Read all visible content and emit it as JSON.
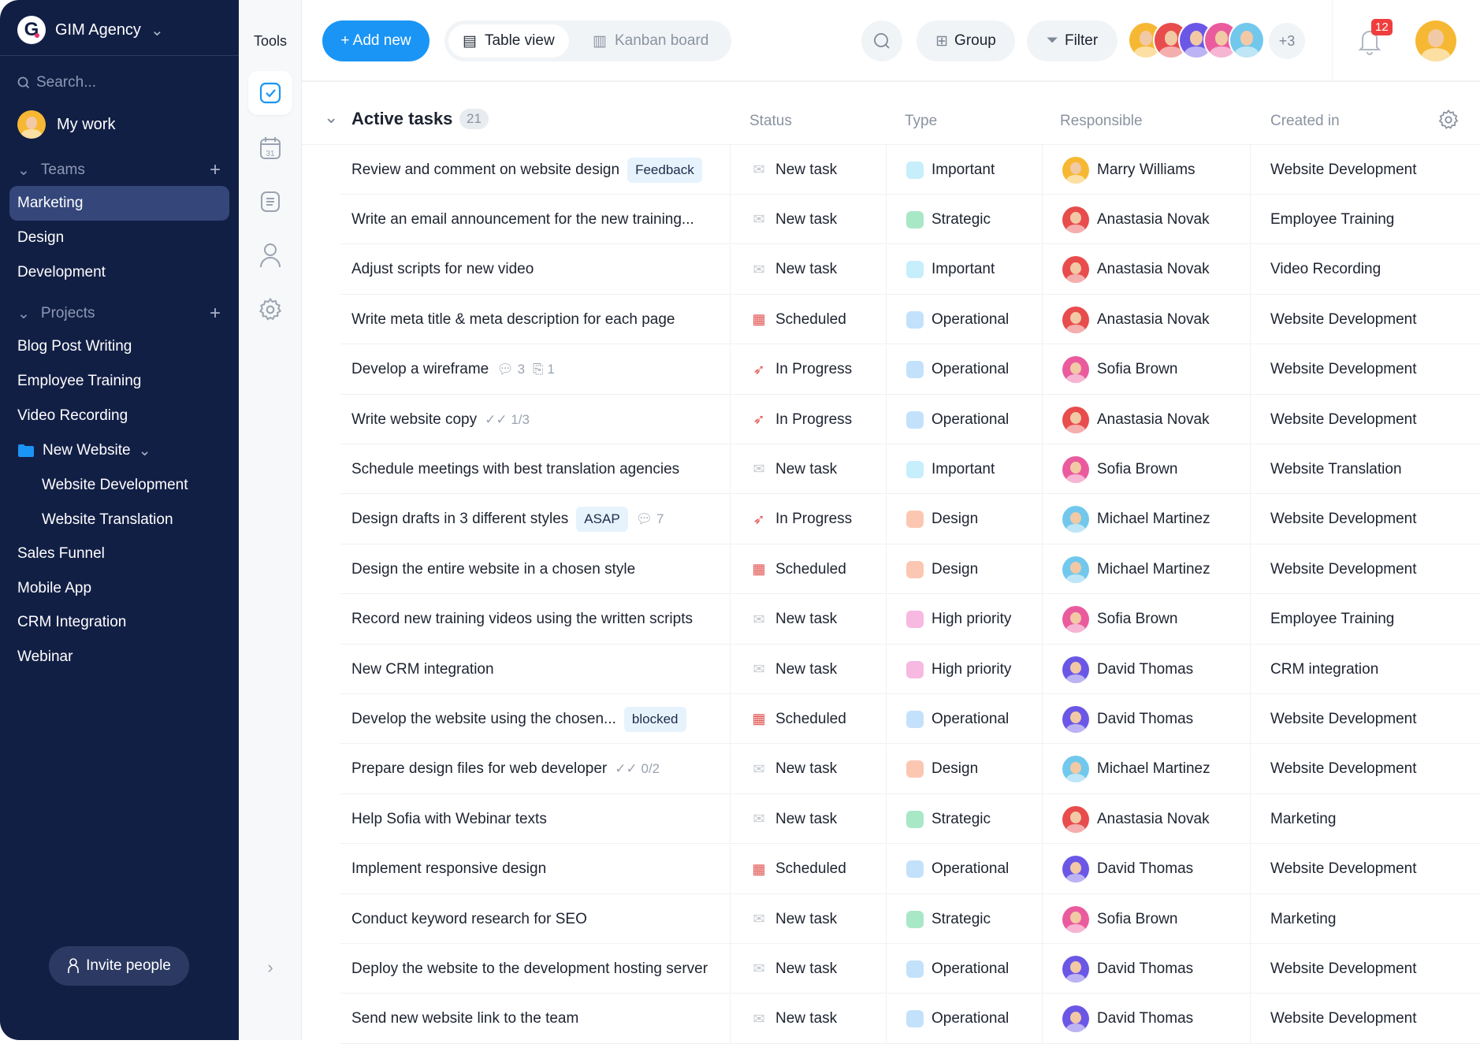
{
  "sidebar": {
    "workspace": "GIM Agency",
    "search_placeholder": "Search...",
    "my_work": "My work",
    "teams_label": "Teams",
    "teams": [
      "Marketing",
      "Design",
      "Development"
    ],
    "projects_label": "Projects",
    "projects": [
      "Blog Post Writing",
      "Employee Training",
      "Video Recording"
    ],
    "folder": "New Website",
    "folder_items": [
      "Website Development",
      "Website Translation"
    ],
    "projects_more": [
      "Sales Funnel",
      "Mobile App",
      "CRM Integration",
      "Webinar"
    ],
    "invite": "Invite people"
  },
  "tools": {
    "title": "Tools",
    "calendar_day": "31"
  },
  "header": {
    "add_new": "+ Add new",
    "table_view": "Table view",
    "kanban": "Kanban board",
    "group": "Group",
    "filter": "Filter",
    "more_members": "+3",
    "notifications": "12"
  },
  "group": {
    "title": "Active tasks",
    "count": "21",
    "columns": {
      "status": "Status",
      "type": "Type",
      "responsible": "Responsible",
      "created": "Created in"
    }
  },
  "colors": {
    "accent": "#1a95f5",
    "sidebar": "#121f45",
    "types": {
      "Important": "#c6eefb",
      "Strategic": "#a9e8c6",
      "Operational": "#c3e1fb",
      "Design": "#fcc7b2",
      "High priority": "#f7b8e2"
    },
    "people": {
      "Marry Williams": "#f6b833",
      "Anastasia Novak": "#e84c4c",
      "Sofia Brown": "#ea5b9e",
      "Michael Martinez": "#72c8ec",
      "David Thomas": "#6b57e6"
    }
  },
  "tasks": [
    {
      "name": "Review and comment on website design",
      "tag": "Feedback",
      "status": "New task",
      "type": "Important",
      "responsible": "Marry Williams",
      "created": "Website Development"
    },
    {
      "name": "Write an email announcement for the new training...",
      "status": "New task",
      "type": "Strategic",
      "responsible": "Anastasia Novak",
      "created": "Employee Training"
    },
    {
      "name": "Adjust scripts for new video",
      "status": "New task",
      "type": "Important",
      "responsible": "Anastasia Novak",
      "created": "Video Recording"
    },
    {
      "name": "Write meta title & meta description for each page",
      "status": "Scheduled",
      "type": "Operational",
      "responsible": "Anastasia Novak",
      "created": "Website Development"
    },
    {
      "name": "Develop a wireframe",
      "comments": "3",
      "attachments": "1",
      "status": "In Progress",
      "type": "Operational",
      "responsible": "Sofia Brown",
      "created": "Website Development"
    },
    {
      "name": "Write website copy",
      "checklist": "1/3",
      "status": "In Progress",
      "type": "Operational",
      "responsible": "Anastasia Novak",
      "created": "Website Development"
    },
    {
      "name": "Schedule meetings with best translation agencies",
      "status": "New task",
      "type": "Important",
      "responsible": "Sofia Brown",
      "created": "Website Translation"
    },
    {
      "name": "Design drafts in 3 different styles",
      "tag": "ASAP",
      "comments": "7",
      "status": "In Progress",
      "type": "Design",
      "responsible": "Michael Martinez",
      "created": "Website Development"
    },
    {
      "name": "Design the entire website in a chosen style",
      "status": "Scheduled",
      "type": "Design",
      "responsible": "Michael Martinez",
      "created": "Website Development"
    },
    {
      "name": "Record new training videos using the written scripts",
      "status": "New task",
      "type": "High priority",
      "responsible": "Sofia Brown",
      "created": "Employee Training"
    },
    {
      "name": "New CRM integration",
      "status": "New task",
      "type": "High priority",
      "responsible": "David Thomas",
      "created": "CRM integration"
    },
    {
      "name": "Develop the website using the chosen...",
      "tag": "blocked",
      "status": "Scheduled",
      "type": "Operational",
      "responsible": "David Thomas",
      "created": "Website Development"
    },
    {
      "name": "Prepare design files for web developer",
      "checklist": "0/2",
      "status": "New task",
      "type": "Design",
      "responsible": "Michael Martinez",
      "created": "Website Development"
    },
    {
      "name": "Help Sofia with Webinar texts",
      "status": "New task",
      "type": "Strategic",
      "responsible": "Anastasia Novak",
      "created": "Marketing"
    },
    {
      "name": "Implement responsive design",
      "status": "Scheduled",
      "type": "Operational",
      "responsible": "David Thomas",
      "created": "Website Development"
    },
    {
      "name": "Conduct keyword research for SEO",
      "status": "New task",
      "type": "Strategic",
      "responsible": "Sofia Brown",
      "created": "Marketing"
    },
    {
      "name": "Deploy the website to the development hosting server",
      "status": "New task",
      "type": "Operational",
      "responsible": "David Thomas",
      "created": "Website Development"
    },
    {
      "name": "Send new website link to the team",
      "status": "New task",
      "type": "Operational",
      "responsible": "David Thomas",
      "created": "Website Development"
    }
  ]
}
